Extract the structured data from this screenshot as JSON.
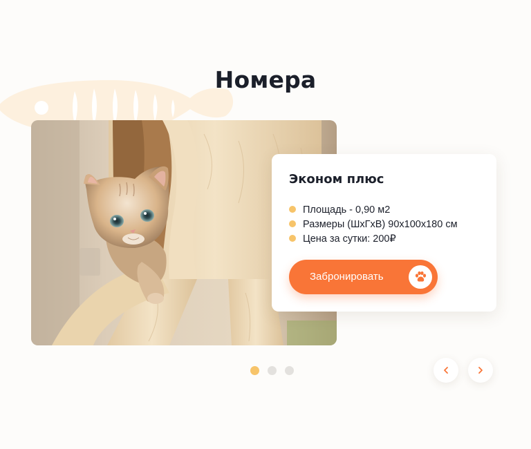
{
  "section": {
    "title": "Номера"
  },
  "card": {
    "title": "Эконом плюс",
    "features": [
      "Площадь - 0,90 м2",
      "Размеры (ШхГхВ) 90х100х180 см",
      "Цена за сутки: 200₽"
    ],
    "book_label": "Забронировать"
  },
  "slider": {
    "total_slides": 3,
    "active_slide": 1
  },
  "colors": {
    "accent_orange": "#f97537",
    "bullet_yellow": "#f7c46a",
    "title_dark": "#1b1f2a",
    "fish_decor": "#fdf0de"
  },
  "icons": {
    "book_button_icon": "paw-icon",
    "prev": "chevron-left-icon",
    "next": "chevron-right-icon",
    "decor": "fish-bone-icon"
  }
}
